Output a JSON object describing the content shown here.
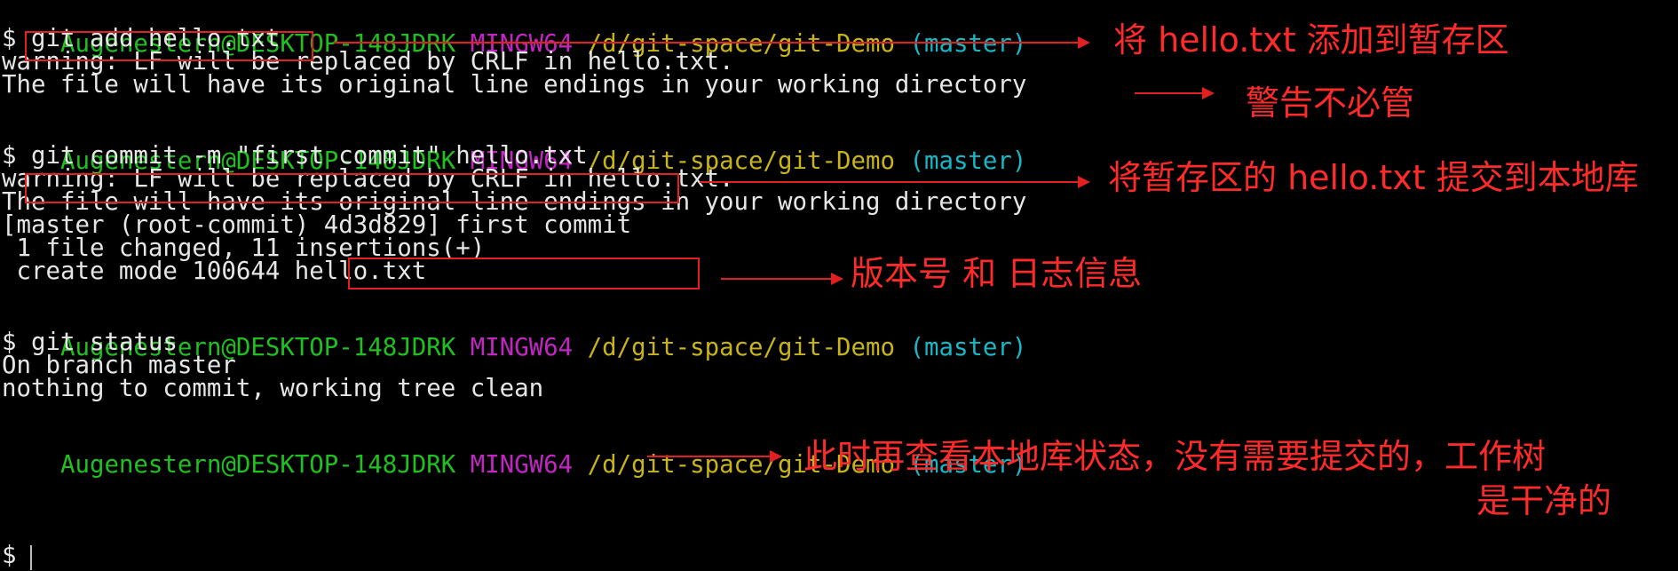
{
  "prompt": {
    "user": "Augenestern@DESKTOP-148JDRK",
    "shell": "MINGW64",
    "path": "/d/git-space/git-Demo",
    "branch": "(master)",
    "symbol": "$"
  },
  "session1": {
    "command": "git add hello.txt",
    "out1": "warning: LF will be replaced by CRLF in hello.txt.",
    "out2": "The file will have its original line endings in your working directory"
  },
  "session2": {
    "command": "git commit -m \"first commit\" hello.txt",
    "out1": "warning: LF will be replaced by CRLF in hello.txt.",
    "out2": "The file will have its original line endings in your working directory",
    "commit_prefix": "[master (root-commit) ",
    "commit_id": "4d3d829",
    "commit_msg": "] first commit",
    "stats": " 1 file changed, 11 insertions(+)",
    "create": " create mode 100644 hello.txt"
  },
  "session3": {
    "command": "git status",
    "out1": "On branch master",
    "out2": "nothing to commit, working tree clean"
  },
  "annotations": {
    "add": "将 hello.txt 添加到暂存区",
    "warning": "警告不必管",
    "commit": "将暂存区的 hello.txt 提交到本地库",
    "version": "版本号 和 日志信息",
    "status_line1": "此时再查看本地库状态，没有需要提交的，工作树",
    "status_line2": "是干净的"
  },
  "colors": {
    "user": "#1fc01f",
    "shell": "#c226c2",
    "path": "#c8b418",
    "branch": "#16b8c8",
    "annotation": "#ff2a2a"
  }
}
